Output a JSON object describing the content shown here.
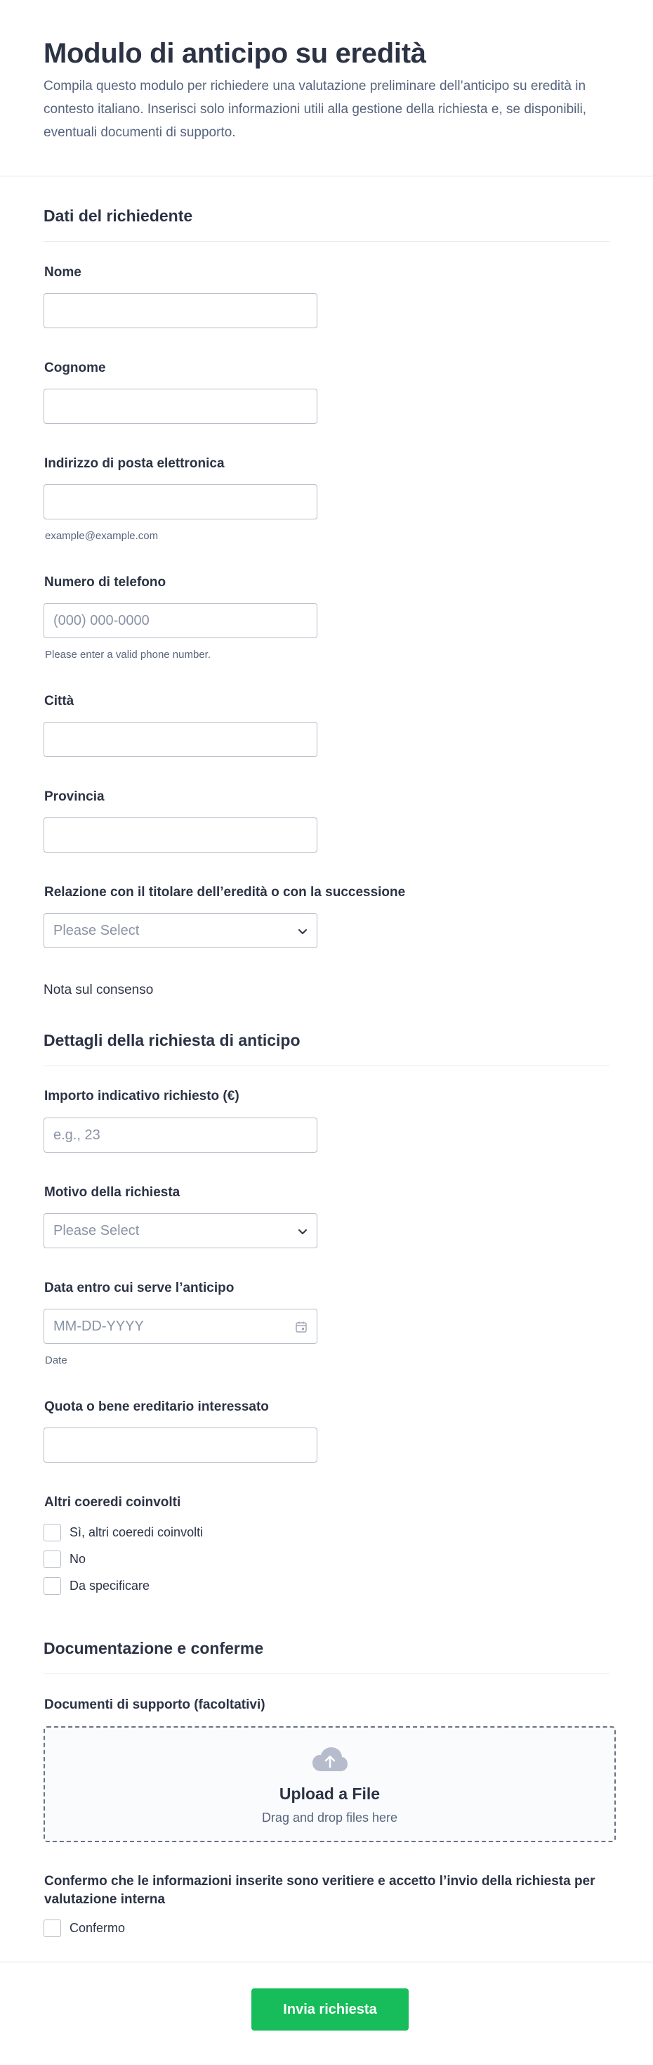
{
  "header": {
    "title": "Modulo di anticipo su eredità",
    "subtitle": "Compila questo modulo per richiedere una valutazione preliminare dell’anticipo su eredità in contesto italiano. Inserisci solo informazioni utili alla gestione della richiesta e, se disponibili, eventuali documenti di supporto."
  },
  "sections": {
    "applicant": "Dati del richiedente",
    "request": "Dettagli della richiesta di anticipo",
    "docs": "Documentazione e conferme"
  },
  "fields": {
    "nome": {
      "label": "Nome",
      "value": ""
    },
    "cognome": {
      "label": "Cognome",
      "value": ""
    },
    "email": {
      "label": "Indirizzo di posta elettronica",
      "value": "",
      "sublabel": "example@example.com"
    },
    "phone": {
      "label": "Numero di telefono",
      "placeholder": "(000) 000-0000",
      "sublabel": "Please enter a valid phone number."
    },
    "citta": {
      "label": "Città",
      "value": ""
    },
    "provincia": {
      "label": "Provincia",
      "value": ""
    },
    "relazione": {
      "label": "Relazione con il titolare dell’eredità o con la successione",
      "placeholder": "Please Select"
    },
    "consent_note": "Nota sul consenso",
    "importo": {
      "label": "Importo indicativo richiesto (€)",
      "placeholder": "e.g., 23"
    },
    "motivo": {
      "label": "Motivo della richiesta",
      "placeholder": "Please Select"
    },
    "data": {
      "label": "Data entro cui serve l’anticipo",
      "placeholder": "MM-DD-YYYY",
      "sublabel": "Date"
    },
    "quota": {
      "label": "Quota o bene ereditario interessato",
      "value": ""
    },
    "coeredi": {
      "label": "Altri coeredi coinvolti",
      "options": [
        "Sì, altri coeredi coinvolti",
        "No",
        "Da specificare"
      ]
    },
    "documenti": {
      "label": "Documenti di supporto (facoltativi)",
      "upload_title": "Upload a File",
      "upload_sub": "Drag and drop files here"
    },
    "conferma": {
      "label": "Confermo che le informazioni inserite sono veritiere e accetto l’invio della richiesta per valutazione interna",
      "option": "Confermo"
    }
  },
  "submit_label": "Invia richiesta",
  "colors": {
    "submit": "#18bd5b",
    "text": "#2c3345",
    "muted": "#57647e",
    "border": "#b8bdc9"
  }
}
